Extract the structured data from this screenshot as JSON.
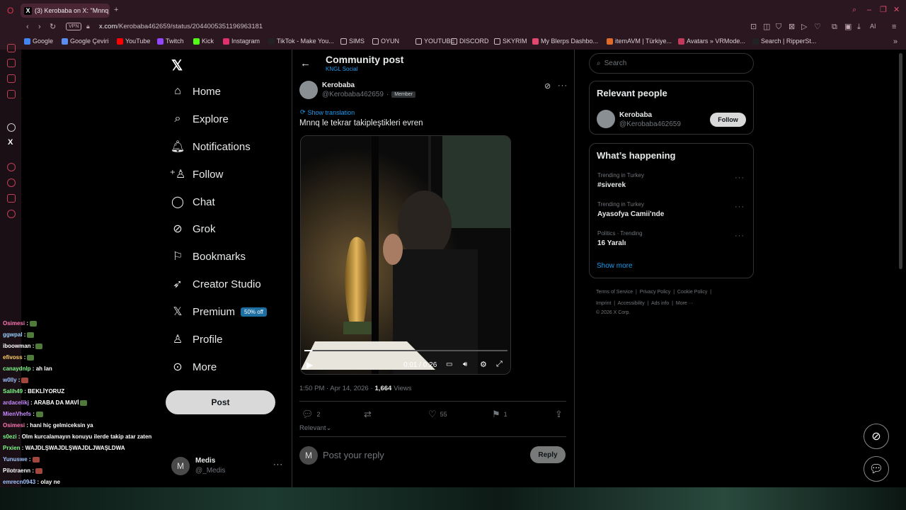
{
  "browser": {
    "tab_title": "(3) Kerobaba on X: \"Mnnq",
    "url_domain": "x.com",
    "url_path": "/Kerobaba462659/status/2044005351196963181",
    "vpn_label": "VPN",
    "ai_label": "AI",
    "bookmarks": [
      {
        "label": "Google",
        "color": "#4285f4"
      },
      {
        "label": "Google Çeviri",
        "color": "#5b8ef0"
      },
      {
        "label": "YouTube",
        "color": "#ff0000"
      },
      {
        "label": "Twitch",
        "color": "#9146ff"
      },
      {
        "label": "Kick",
        "color": "#53fc18"
      },
      {
        "label": "Instagram",
        "color": "#e1306c"
      },
      {
        "label": "TikTok - Make You...",
        "color": "#222"
      },
      {
        "label": "SIMS",
        "color": "folder"
      },
      {
        "label": "OYUN",
        "color": "folder"
      },
      {
        "label": "YOUTUBE",
        "color": "folder"
      },
      {
        "label": "DISCORD",
        "color": "folder"
      },
      {
        "label": "SKYRIM",
        "color": "folder"
      },
      {
        "label": "My Blerps Dashbo...",
        "color": "#e2476f"
      },
      {
        "label": "itemAVM | Türkiye...",
        "color": "#e06a2a"
      },
      {
        "label": "Avatars » VRMode...",
        "color": "#c23a5a"
      },
      {
        "label": "Search | RipperSt...",
        "color": "#222"
      }
    ]
  },
  "nav": {
    "items": [
      {
        "label": "Home",
        "icon": "home-icon"
      },
      {
        "label": "Explore",
        "icon": "search-icon"
      },
      {
        "label": "Notifications",
        "icon": "bell-icon"
      },
      {
        "label": "Follow",
        "icon": "follow-icon"
      },
      {
        "label": "Chat",
        "icon": "chat-icon"
      },
      {
        "label": "Grok",
        "icon": "grok-icon"
      },
      {
        "label": "Bookmarks",
        "icon": "bookmark-icon"
      },
      {
        "label": "Creator Studio",
        "icon": "rocket-icon"
      },
      {
        "label": "Premium",
        "icon": "x-icon"
      },
      {
        "label": "Profile",
        "icon": "person-icon"
      },
      {
        "label": "More",
        "icon": "more-icon"
      }
    ],
    "premium_badge": "50% off",
    "post_button": "Post",
    "account_name": "Medis",
    "account_handle": "@_Medis",
    "account_initial": "M"
  },
  "post": {
    "header_title": "Community post",
    "header_sub": "KNGL Social",
    "author_name": "Kerobaba",
    "author_handle": "@Kerobaba462659",
    "author_sep": "·",
    "member_badge": "Member",
    "show_translation": "Show translation",
    "text": "Mnnq le tekrar takipleştikleri evren",
    "video_time": "0:01 / 0:26",
    "video_progress": 0.04,
    "meta_time": "1:50 PM · Apr 14, 2026 ·",
    "views_count": "1,664",
    "views_label": "Views",
    "replies": "2",
    "likes": "55",
    "bookmarks": "1",
    "sort_label": "Relevant",
    "reply_placeholder": "Post your reply",
    "reply_button": "Reply",
    "reply_initial": "M"
  },
  "right": {
    "search_placeholder": "Search",
    "relevant_title": "Relevant people",
    "person_name": "Kerobaba",
    "person_handle": "@Kerobaba462659",
    "follow_button": "Follow",
    "happening_title": "What’s happening",
    "trends": [
      {
        "context": "Trending in Turkey",
        "title": "#siverek"
      },
      {
        "context": "Trending in Turkey",
        "title": "Ayasofya Camii'nde"
      },
      {
        "context": "Politics · Trending",
        "title": "16 Yaralı"
      }
    ],
    "show_more": "Show more",
    "footer": {
      "terms": "Terms of Service",
      "privacy": "Privacy Policy",
      "cookie": "Cookie Policy",
      "imprint": "Imprint",
      "accessibility": "Accessibility",
      "ads": "Ads info",
      "more": "More ···",
      "copyright": "© 2026 X Corp."
    }
  },
  "chat_overlay": [
    {
      "user": "Osimesi",
      "color": "#ff77b5",
      "msg": " :",
      "emote": "g"
    },
    {
      "user": "ggwpal",
      "color": "#9ad1ff",
      "msg": " :",
      "emote": "g"
    },
    {
      "user": "iboowman",
      "color": "#ffffff",
      "msg": " :",
      "emote": "g"
    },
    {
      "user": "efivoss",
      "color": "#ffd166",
      "msg": " :",
      "emote": "g"
    },
    {
      "user": "canaydnlp",
      "color": "#7cfc8a",
      "msg": " : ah lan",
      "emote": ""
    },
    {
      "user": "w0lly",
      "color": "#a0c4ff",
      "msg": " :",
      "emote": "r"
    },
    {
      "user": "Salih49",
      "color": "#7cfc8a",
      "msg": " : BEKLİYORUZ",
      "emote": ""
    },
    {
      "user": "ardacelikj",
      "color": "#c78cff",
      "msg": " : ARABA DA MAVİ",
      "emote": "g"
    },
    {
      "user": "MienVhefs",
      "color": "#c78cff",
      "msg": " :",
      "emote": "g"
    },
    {
      "user": "Osimesi",
      "color": "#ff77b5",
      "msg": " : hani hiç gelmiceksin ya",
      "emote": ""
    },
    {
      "user": "s0ezi",
      "color": "#7cfc8a",
      "msg": " : Olm kurcalamayın konuyu ilerde takip atar zaten",
      "emote": ""
    },
    {
      "user": "Prxien",
      "color": "#7cfc8a",
      "msg": " : WAJDLŞWAJDLŞWAJDLJWAŞLDWA",
      "emote": ""
    },
    {
      "user": "Yunuswe",
      "color": "#a0c4ff",
      "msg": " :",
      "emote": "r"
    },
    {
      "user": "Pilotraenn",
      "color": "#ffffff",
      "msg": " :",
      "emote": "r"
    },
    {
      "user": "emrecn0943",
      "color": "#a0c4ff",
      "msg": " : olay ne",
      "emote": ""
    }
  ]
}
